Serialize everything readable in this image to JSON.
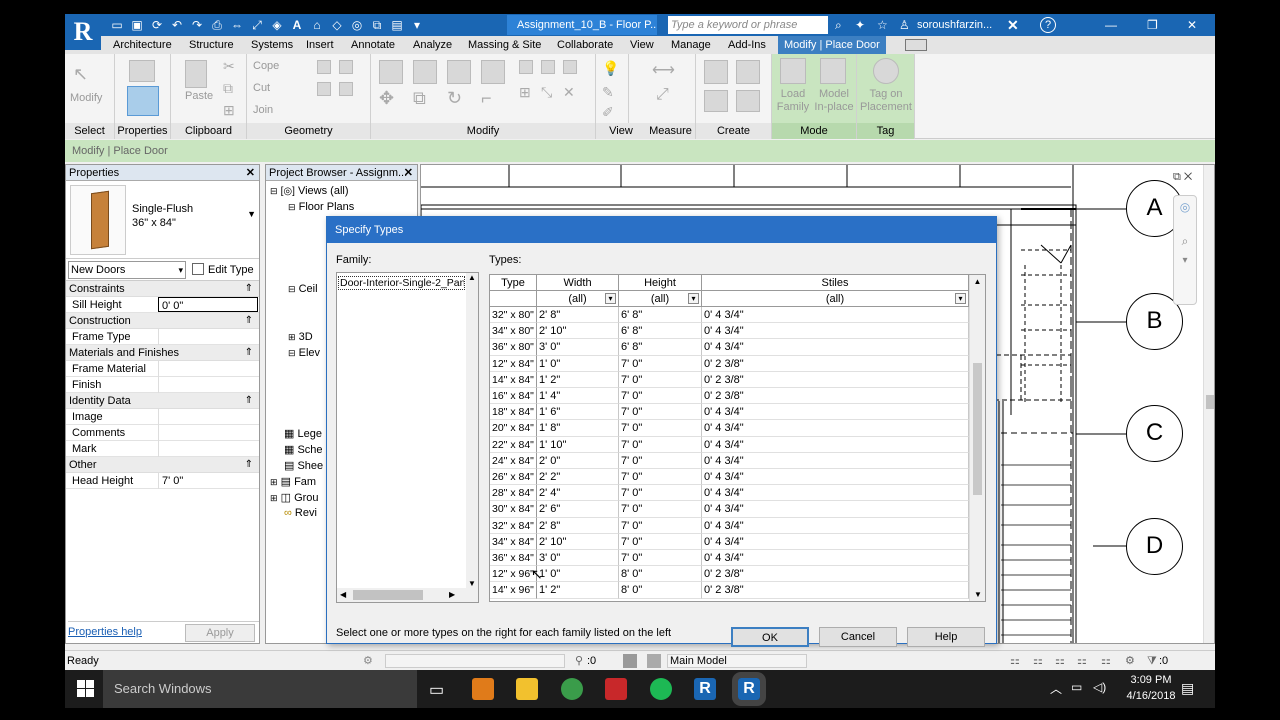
{
  "app": {
    "logo": "R",
    "title_tab": "Assignment_10_B - Floor P...",
    "search_placeholder": "Type a keyword or phrase",
    "user": "soroushfarzin...",
    "help": "?"
  },
  "tabs": [
    "Architecture",
    "Structure",
    "Systems",
    "Insert",
    "Annotate",
    "Analyze",
    "Massing & Site",
    "Collaborate",
    "View",
    "Manage",
    "Add-Ins",
    "Modify | Place Door"
  ],
  "ribbon": {
    "panels": [
      "Select",
      "Properties",
      "Clipboard",
      "Geometry",
      "Modify",
      "View",
      "Measure",
      "Create",
      "Mode",
      "Tag"
    ],
    "modify_label": "Modify",
    "paste_label": "Paste",
    "cope_label": "Cope",
    "cut_label": "Cut",
    "join_label": "Join",
    "load_family_label": "Load Family",
    "model_inplace_label": "Model In-place",
    "tag_placement_label": "Tag on Placement"
  },
  "options_bar": "Modify | Place Door",
  "properties": {
    "header": "Properties",
    "family_name": "Single-Flush",
    "family_size": "36\" x 84\"",
    "filter": "New Doors",
    "edit_type": "Edit Type",
    "groups": [
      {
        "name": "Constraints",
        "rows": [
          {
            "k": "Sill Height",
            "v": "0'  0\""
          }
        ]
      },
      {
        "name": "Construction",
        "rows": [
          {
            "k": "Frame Type",
            "v": ""
          }
        ]
      },
      {
        "name": "Materials and Finishes",
        "rows": [
          {
            "k": "Frame Material",
            "v": ""
          },
          {
            "k": "Finish",
            "v": ""
          }
        ]
      },
      {
        "name": "Identity Data",
        "rows": [
          {
            "k": "Image",
            "v": ""
          },
          {
            "k": "Comments",
            "v": ""
          },
          {
            "k": "Mark",
            "v": ""
          }
        ]
      },
      {
        "name": "Other",
        "rows": [
          {
            "k": "Head Height",
            "v": "7'  0\""
          }
        ]
      }
    ],
    "help_link": "Properties help",
    "apply": "Apply"
  },
  "browser": {
    "header": "Project Browser - Assignm...",
    "items": [
      "Views (all)",
      "Floor Plans",
      "Ceil",
      "3D",
      "Elev",
      "Lege",
      "Sche",
      "Shee",
      "Fam",
      "Grou",
      "Revi"
    ]
  },
  "grid_labels": [
    "A",
    "B",
    "C",
    "D"
  ],
  "dialog": {
    "title": "Specify Types",
    "family_label": "Family:",
    "types_label": "Types:",
    "family_item": "Door-Interior-Single-2_Pane",
    "columns": [
      "Type",
      "Width",
      "Height",
      "Stiles"
    ],
    "filters": [
      "(all)",
      "(all)",
      "(all)"
    ],
    "rows": [
      [
        "32\" x 80\"",
        "2'  8\"",
        "6'  8\"",
        "0'  4 3/4\""
      ],
      [
        "34\" x 80\"",
        "2'  10\"",
        "6'  8\"",
        "0'  4 3/4\""
      ],
      [
        "36\" x 80\"",
        "3'  0\"",
        "6'  8\"",
        "0'  4 3/4\""
      ],
      [
        "12\" x 84\"",
        "1'  0\"",
        "7'  0\"",
        "0'  2 3/8\""
      ],
      [
        "14\" x 84\"",
        "1'  2\"",
        "7'  0\"",
        "0'  2 3/8\""
      ],
      [
        "16\" x 84\"",
        "1'  4\"",
        "7'  0\"",
        "0'  2 3/8\""
      ],
      [
        "18\" x 84\"",
        "1'  6\"",
        "7'  0\"",
        "0'  4 3/4\""
      ],
      [
        "20\" x 84\"",
        "1'  8\"",
        "7'  0\"",
        "0'  4 3/4\""
      ],
      [
        "22\" x 84\"",
        "1'  10\"",
        "7'  0\"",
        "0'  4 3/4\""
      ],
      [
        "24\" x 84\"",
        "2'  0\"",
        "7'  0\"",
        "0'  4 3/4\""
      ],
      [
        "26\" x 84\"",
        "2'  2\"",
        "7'  0\"",
        "0'  4 3/4\""
      ],
      [
        "28\" x 84\"",
        "2'  4\"",
        "7'  0\"",
        "0'  4 3/4\""
      ],
      [
        "30\" x 84\"",
        "2'  6\"",
        "7'  0\"",
        "0'  4 3/4\""
      ],
      [
        "32\" x 84\"",
        "2'  8\"",
        "7'  0\"",
        "0'  4 3/4\""
      ],
      [
        "34\" x 84\"",
        "2'  10\"",
        "7'  0\"",
        "0'  4 3/4\""
      ],
      [
        "36\" x 84\"",
        "3'  0\"",
        "7'  0\"",
        "0'  4 3/4\""
      ],
      [
        "12\" x 96\"",
        "1'  0\"",
        "8'  0\"",
        "0'  2 3/8\""
      ],
      [
        "14\" x 96\"",
        "1'  2\"",
        "8'  0\"",
        "0'  2 3/8\""
      ]
    ],
    "hint": "Select one or more types on the right for each family listed on the left",
    "ok": "OK",
    "cancel": "Cancel",
    "help": "Help"
  },
  "status": {
    "text": "Ready",
    "count": ":0",
    "model": "Main Model",
    "filter_count": ":0"
  },
  "taskbar": {
    "search": "Search Windows",
    "time": "3:09 PM",
    "date": "4/16/2018"
  }
}
